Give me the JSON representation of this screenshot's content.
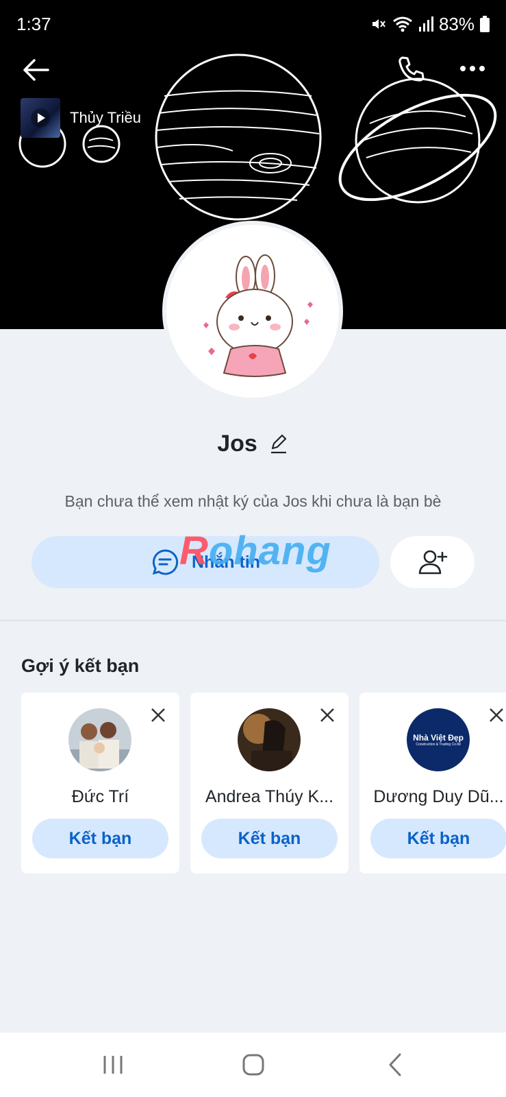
{
  "status": {
    "time": "1:37",
    "battery": "83%"
  },
  "music": {
    "title": "Thủy Triều"
  },
  "profile": {
    "name": "Jos",
    "note": "Bạn chưa thể xem nhật ký của Jos khi chưa là bạn bè",
    "message_label": "Nhắn tin"
  },
  "watermark": {
    "first": "R",
    "rest": "ohang"
  },
  "suggestions": {
    "title": "Gợi ý kết bạn",
    "items": [
      {
        "name": "Đức Trí",
        "button": "Kết bạn"
      },
      {
        "name": "Andrea Thúy K...",
        "button": "Kết bạn"
      },
      {
        "name": "Dương Duy Dũ...",
        "button": "Kết bạn",
        "logo_text": "Nhà Việt Đẹp",
        "logo_sub": "Construction & Trading Co.ltd"
      }
    ]
  },
  "colors": {
    "accent": "#0a62c9",
    "accent_soft": "#d6e8fd",
    "background": "#eef1f5"
  }
}
